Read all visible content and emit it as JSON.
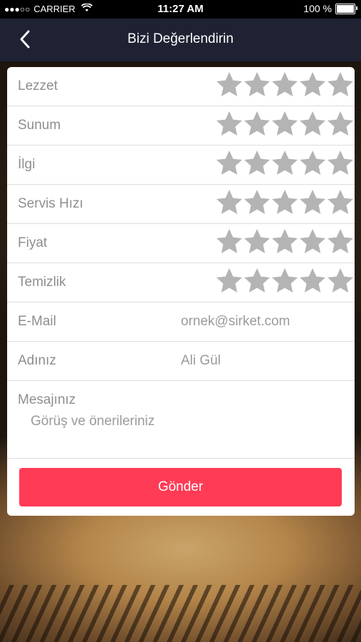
{
  "status_bar": {
    "signal": "●●●○○",
    "carrier": "CARRIER",
    "time": "11:27 AM",
    "battery": "100 %"
  },
  "nav": {
    "title": "Bizi Değerlendirin",
    "back_icon": "chevron-left-icon"
  },
  "ratings": [
    {
      "label": "Lezzet",
      "value": 0,
      "max": 5
    },
    {
      "label": "Sunum",
      "value": 0,
      "max": 5
    },
    {
      "label": "İlgi",
      "value": 0,
      "max": 5
    },
    {
      "label": "Servis Hızı",
      "value": 0,
      "max": 5
    },
    {
      "label": "Fiyat",
      "value": 0,
      "max": 5
    },
    {
      "label": "Temizlik",
      "value": 0,
      "max": 5
    }
  ],
  "fields": {
    "email": {
      "label": "E-Mail",
      "placeholder": "ornek@sirket.com"
    },
    "name": {
      "label": "Adınız",
      "placeholder": "Ali Gül"
    },
    "message": {
      "label": "Mesajınız",
      "placeholder": "Görüş ve önerileriniz"
    }
  },
  "submit_label": "Gönder",
  "colors": {
    "nav_bg": "#1e2233",
    "star_empty": "#b4b4b4",
    "button": "#ff3b55"
  }
}
